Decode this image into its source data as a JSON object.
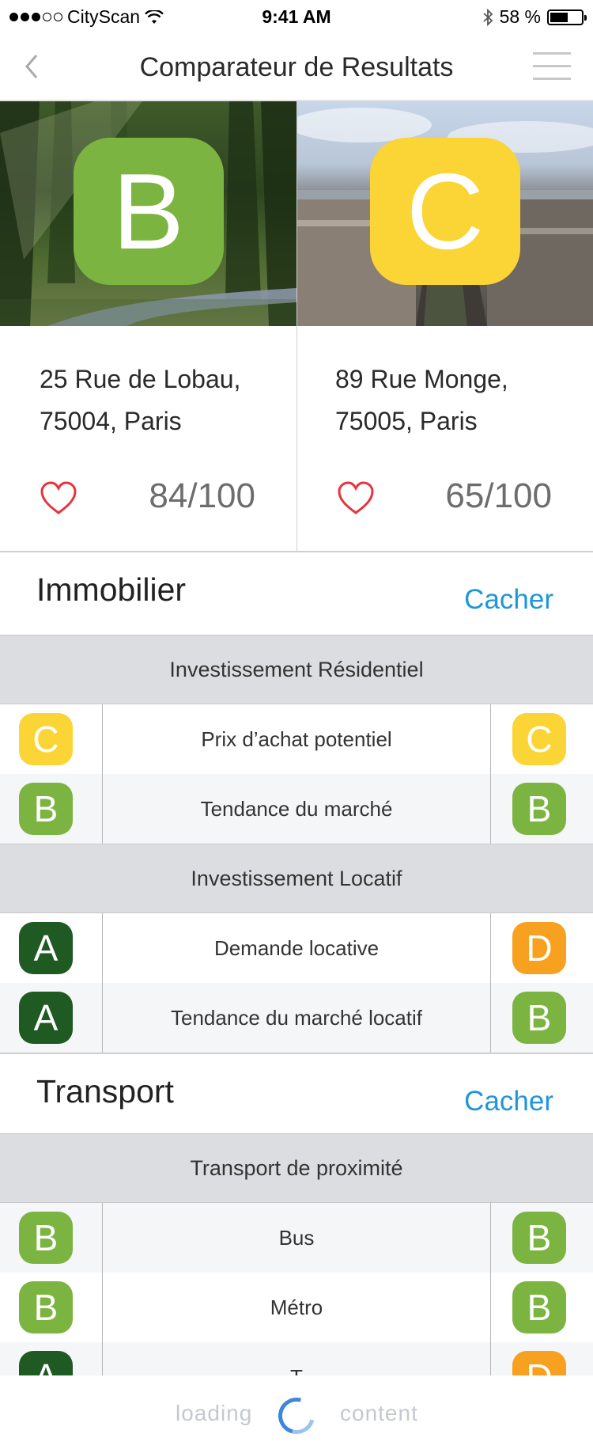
{
  "status_bar": {
    "carrier": "CityScan",
    "time": "9:41 AM",
    "battery_text": "58 %",
    "battery_level": 0.58
  },
  "nav": {
    "title": "Comparateur de Resultats",
    "back_icon": "chevron-left-icon",
    "menu_icon": "hamburger-menu-icon"
  },
  "properties": [
    {
      "grade": "B",
      "grade_color": "#7cb442",
      "address_line1": "25 Rue de Lobau,",
      "address_line2": "75004, Paris",
      "score": "84/100"
    },
    {
      "grade": "C",
      "grade_color": "#fbd535",
      "address_line1": "89 Rue Monge,",
      "address_line2": "75005, Paris",
      "score": "65/100"
    }
  ],
  "sections": [
    {
      "title": "Immobilier",
      "hide_label": "Cacher",
      "groups": [
        {
          "subtitle": "Investissement Résidentiel",
          "rows": [
            {
              "label": "Prix d’achat potentiel",
              "left": "C",
              "right": "C"
            },
            {
              "label": "Tendance du marché",
              "left": "B",
              "right": "B"
            }
          ]
        },
        {
          "subtitle": "Investissement Locatif",
          "rows": [
            {
              "label": "Demande locative",
              "left": "A",
              "right": "D"
            },
            {
              "label": "Tendance du marché locatif",
              "left": "A",
              "right": "B"
            }
          ]
        }
      ]
    },
    {
      "title": "Transport",
      "hide_label": "Cacher",
      "groups": [
        {
          "subtitle": "Transport de proximité",
          "rows": [
            {
              "label": "Bus",
              "left": "B",
              "right": "B"
            },
            {
              "label": "Métro",
              "left": "B",
              "right": "B"
            },
            {
              "label": "T",
              "left": "A",
              "right": "D"
            }
          ]
        }
      ]
    }
  ],
  "grade_colors": {
    "A": "#1f5a23",
    "B": "#7cb442",
    "C": "#fbd535",
    "D": "#f8a020"
  },
  "footer": {
    "loading_text": "loading",
    "content_text": "content"
  }
}
